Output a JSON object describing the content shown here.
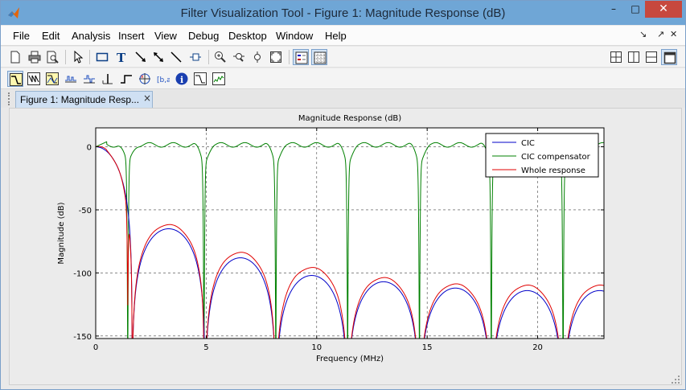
{
  "window": {
    "title": "Filter Visualization Tool - Figure 1: Magnitude Response (dB)",
    "icon": "matlab-logo-icon",
    "controls": {
      "minimize": "–",
      "maximize": "□",
      "close": "✕"
    }
  },
  "menu": {
    "items": [
      "File",
      "Edit",
      "Analysis",
      "Insert",
      "View",
      "Debug",
      "Desktop",
      "Window",
      "Help"
    ],
    "right_icons": [
      "undock-arrow-icon",
      "dock-arrow-icon",
      "close-figure-icon"
    ]
  },
  "toolbar1": {
    "left": [
      "new-icon",
      "print-icon",
      "print-preview-icon",
      "pointer-icon",
      "rectangle-icon",
      "text-icon",
      "arrow-icon",
      "double-arrow-icon",
      "line-icon",
      "pin-icon",
      "zoom-in-icon",
      "zoom-x-icon",
      "zoom-y-icon",
      "full-view-icon",
      "legend-icon",
      "grid-icon"
    ],
    "right": [
      "tile-grid-icon",
      "tile-vertical-icon",
      "tile-horizontal-icon",
      "maximize-pane-icon"
    ]
  },
  "toolbar2": {
    "items": [
      "magnitude-response-icon",
      "phase-response-icon",
      "magnitude-phase-icon",
      "group-delay-icon",
      "phase-delay-icon",
      "impulse-response-icon",
      "step-response-icon",
      "pole-zero-icon",
      "coefficients-icon",
      "info-icon",
      "magnitude-estimate-icon",
      "noise-power-icon"
    ]
  },
  "tab": {
    "label": "Figure 1: Magnitude Resp...",
    "close": "×"
  },
  "chart_data": {
    "type": "line",
    "title": "Magnitude Response (dB)",
    "xlabel": "Frequency (MHz)",
    "ylabel": "Magnitude (dB)",
    "xlim": [
      0,
      23
    ],
    "ylim": [
      -152,
      15
    ],
    "xticks": [
      0,
      5,
      10,
      15,
      20
    ],
    "xtick_labels": [
      "0",
      "5",
      "10",
      "15",
      "20"
    ],
    "yticks": [
      0,
      -50,
      -100,
      -150
    ],
    "ytick_labels": [
      "0",
      "-50",
      "-100",
      "-150"
    ],
    "grid": true,
    "legend_position": "top-right",
    "series": [
      {
        "name": "CIC",
        "color": "#0000c8",
        "model": {
          "kind": "cic",
          "nulls_mhz": [
            1.65,
            4.95,
            8.15,
            11.4,
            14.65,
            17.9,
            21.15
          ],
          "lobe_peaks_db": [
            -65,
            -88,
            -102,
            -107,
            -112,
            -114
          ]
        }
      },
      {
        "name": "CIC compensator",
        "color": "#008000",
        "model": {
          "kind": "compensator",
          "notch_mhz": [
            1.45,
            4.9,
            8.15,
            11.4,
            14.65,
            17.9,
            21.15
          ],
          "ripple_db": 5
        }
      },
      {
        "name": "Whole response",
        "color": "#e00000",
        "model": {
          "kind": "cic-plus-compensator",
          "lobe_peaks_db": [
            -62,
            -84,
            -96,
            -104,
            -109,
            -110
          ]
        }
      }
    ]
  }
}
